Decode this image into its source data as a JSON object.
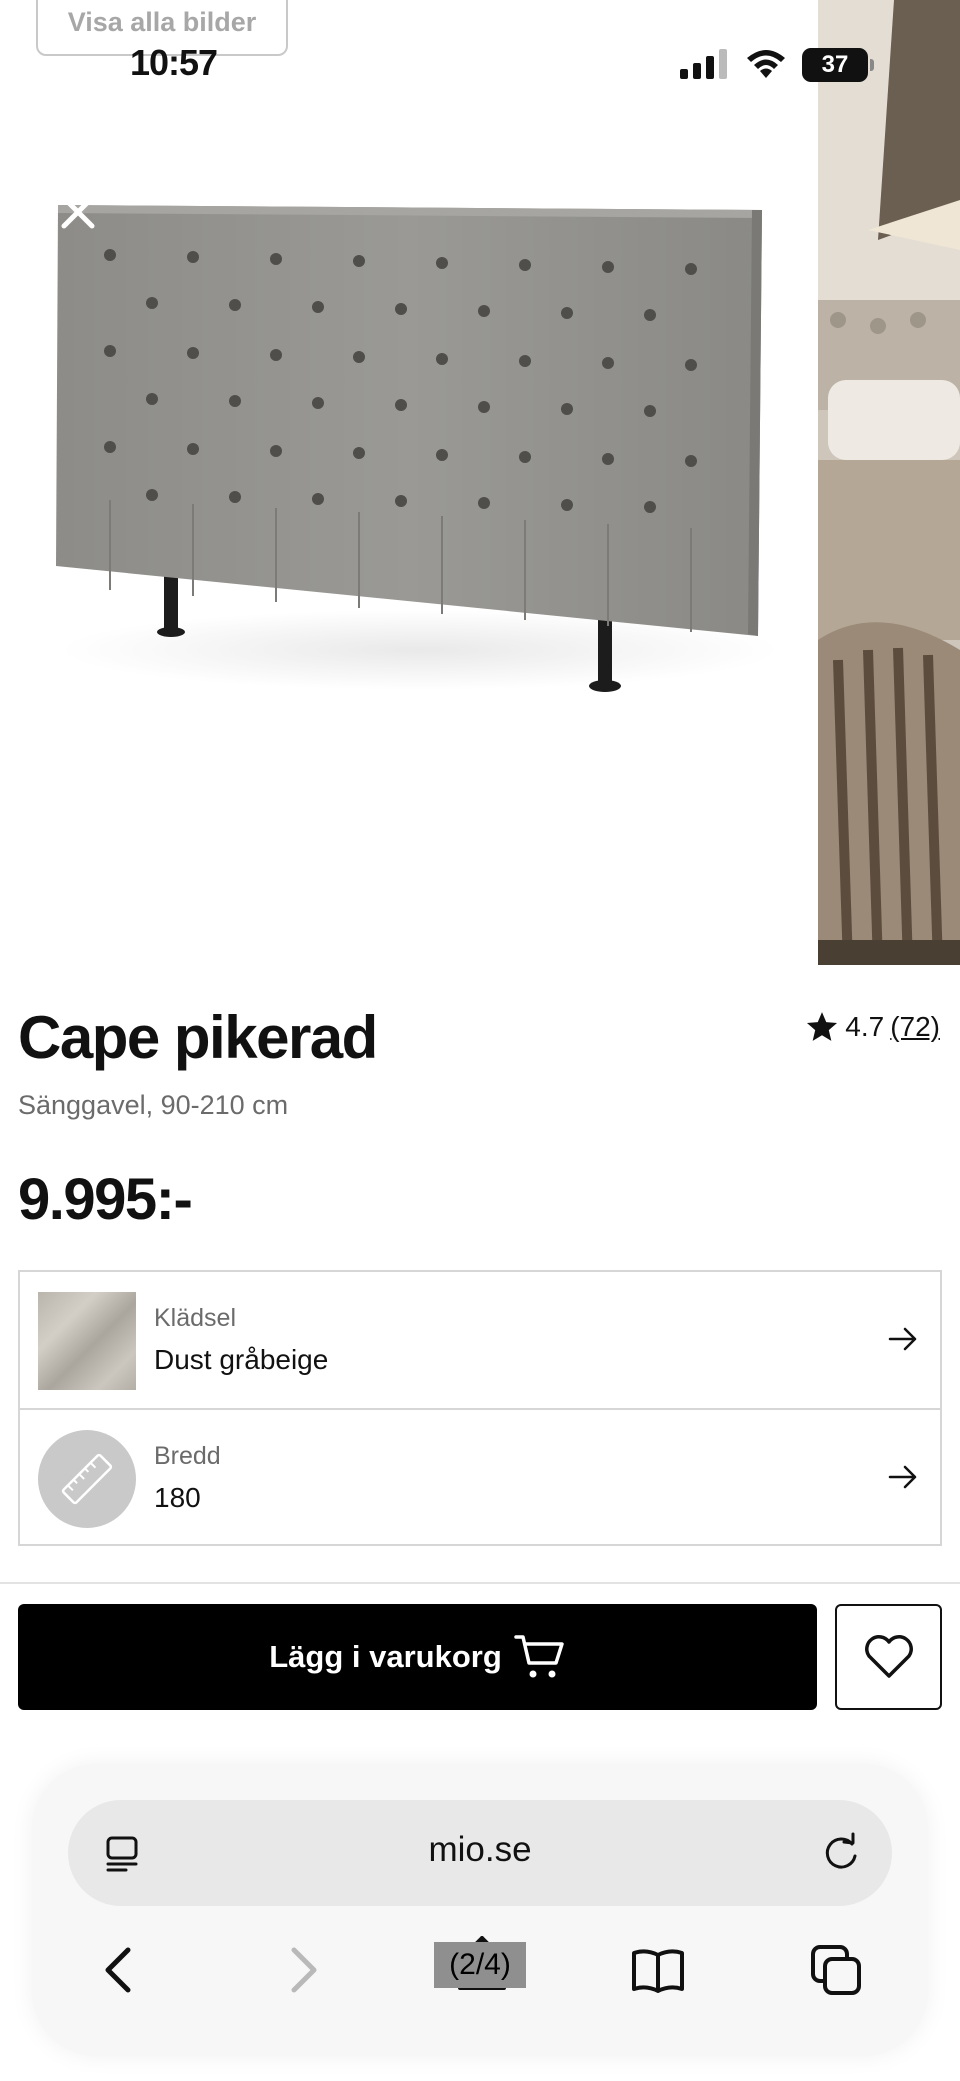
{
  "status_bar": {
    "time": "10:57",
    "battery": "37",
    "gallery_link": "Visa alla bilder"
  },
  "gallery": {
    "main_image": "headboard-product-photo",
    "next_image": "bedroom-lifestyle-photo"
  },
  "product": {
    "title": "Cape pikerad",
    "subtitle": "Sänggavel, 90-210 cm",
    "price": "9.995:-",
    "rating": "4.7",
    "review_count": "(72)"
  },
  "options": [
    {
      "label": "Klädsel",
      "value": "Dust gråbeige"
    },
    {
      "label": "Bredd",
      "value": "180"
    }
  ],
  "actions": {
    "add_to_cart": "Lägg i varukorg"
  },
  "browser": {
    "url": "mio.se",
    "share_overlay": "(2/4)"
  },
  "colors": {
    "accent": "#000000",
    "border": "#d6d6d6",
    "muted_text": "#6b6b6b"
  }
}
